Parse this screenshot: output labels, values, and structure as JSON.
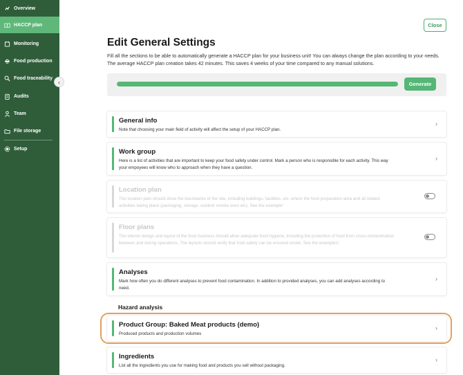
{
  "sidebar": {
    "items": [
      {
        "label": "Overview",
        "icon": "overview-icon"
      },
      {
        "label": "HACCP plan",
        "icon": "book-icon",
        "active": true
      },
      {
        "label": "Monitoring",
        "icon": "monitoring-icon"
      },
      {
        "label": "Food production",
        "icon": "food-production-icon"
      },
      {
        "label": "Food traceability",
        "icon": "search-icon"
      },
      {
        "label": "Audits",
        "icon": "clipboard-icon"
      },
      {
        "label": "Team",
        "icon": "person-icon"
      },
      {
        "label": "File storage",
        "icon": "folder-icon"
      },
      {
        "label": "Setup",
        "icon": "gear-icon"
      }
    ],
    "collapse_icon": "chevron-left-icon",
    "bg_color": "#2f5d3a",
    "active_color": "#5fb87a"
  },
  "header": {
    "close_label": "Close",
    "title": "Edit General Settings",
    "description": "Fill all the sections to be able to automatically generate a HACCP plan for your business unit! You can always change the plan according to your needs. The average HACCP plan creation takes 42 minutes. This saves 4 weeks of your time compared to any manual solutions."
  },
  "progress": {
    "fraction": 1.0,
    "generate_label": "Generate",
    "accent_color": "#55b776"
  },
  "cards": [
    {
      "title": "General info",
      "description": "Note that choosing your main field of activity will affect the setup of your HACCP plan.",
      "disabled": false
    },
    {
      "title": "Work group",
      "description": "Here is a list of activities that are important to keep your food safety under control. Mark a person who is responsible for each activity. This way your empoyees will know who to approach when they have a question.",
      "disabled": false
    },
    {
      "title": "Location plan",
      "description": "The location plan should show the boundaries of the site, including buildings, facilities, etc. where the food preparation area and all related activities taking place (packaging, storage, outdoor smoke oven etc). See the example!",
      "disabled": true,
      "toggle": false
    },
    {
      "title": "Floor plans",
      "description": "The interior design and layout of the food business should allow adequate food hygiene, including the protection of food from cross-contamination between and during operations. The layouts should verify that food safety can be ensured onsite. See the examples!",
      "disabled": true,
      "toggle": false
    },
    {
      "title": "Analyses",
      "description": "Mark how often you do different analyses to prevent food contamination. In addition to provided analyses, you can add analyses according to need.",
      "disabled": false
    }
  ],
  "hazard": {
    "heading": "Hazard analysis",
    "cards": [
      {
        "title": "Product Group: Baked Meat products (demo)",
        "description": "Produced products and production volumes",
        "highlighted": true
      },
      {
        "title": "Ingredients",
        "description": "List all the ingredients you use for making food and products you sell without packaging."
      }
    ]
  },
  "chevron_glyph": "›",
  "highlight_color": "#e2a15a"
}
